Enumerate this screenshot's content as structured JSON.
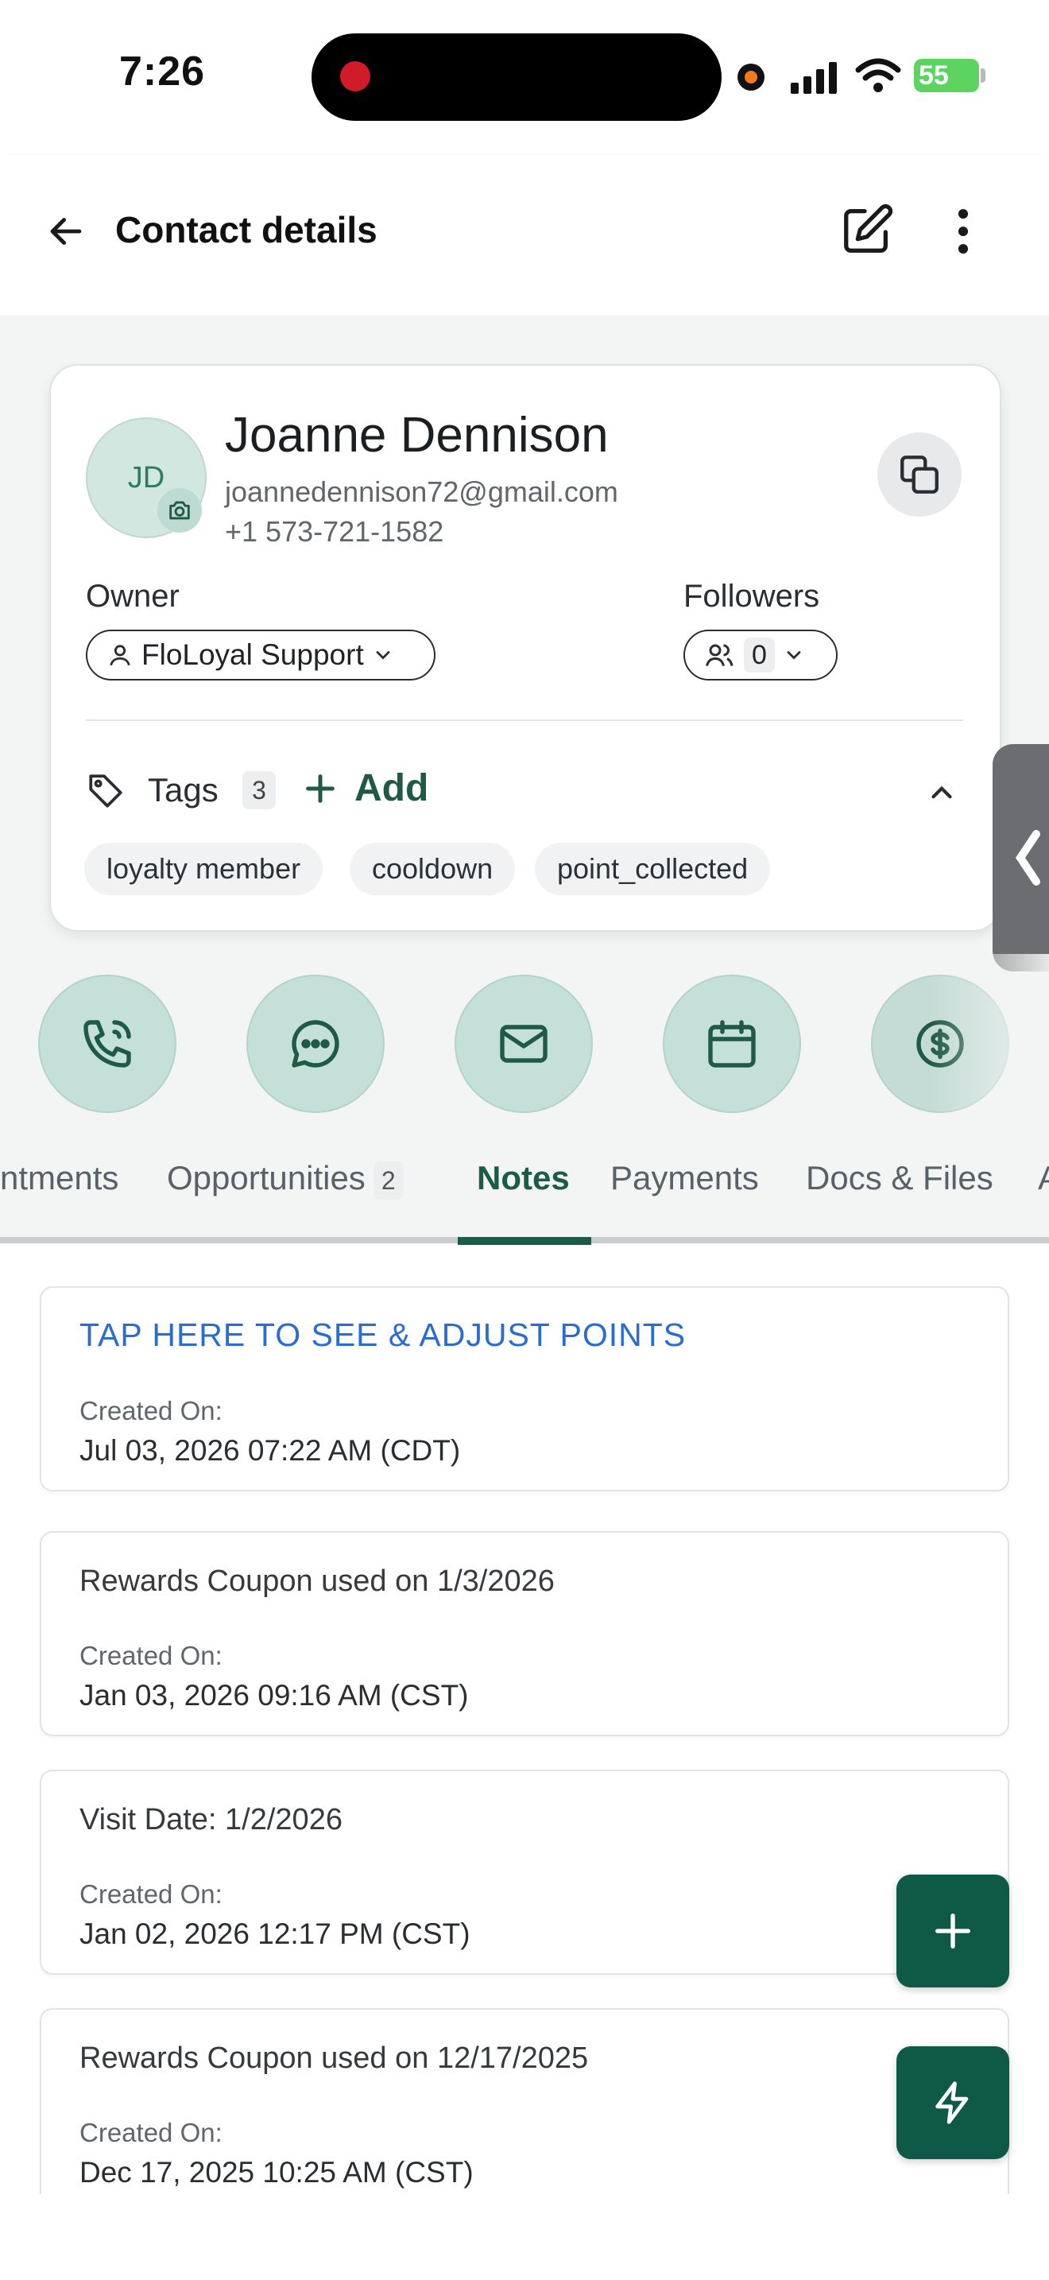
{
  "status_bar": {
    "time": "7:26",
    "battery": "55"
  },
  "header": {
    "title": "Contact details"
  },
  "contact": {
    "initials": "JD",
    "name": "Joanne Dennison",
    "email": "joannedennison72@gmail.com",
    "phone": "+1 573-721-1582",
    "owner_label": "Owner",
    "owner_value": "FloLoyal Support",
    "followers_label": "Followers",
    "followers_count": "0",
    "tags_label": "Tags",
    "tags_count": "3",
    "add_label": "Add",
    "tags": [
      "loyalty member",
      "cooldown",
      "point_collected"
    ]
  },
  "actions": [
    "phone-icon",
    "chat-icon",
    "mail-icon",
    "calendar-icon",
    "dollar-icon"
  ],
  "tabs": [
    {
      "label": "ntments"
    },
    {
      "label": "Opportunities",
      "badge": "2"
    },
    {
      "label": "Notes",
      "active": true
    },
    {
      "label": "Payments"
    },
    {
      "label": "Docs & Files"
    },
    {
      "label": "A"
    }
  ],
  "notes": [
    {
      "title": "TAP HERE TO SEE & ADJUST POINTS",
      "created_label": "Created On:",
      "date": "Jul 03, 2026 07:22 AM (CDT)"
    },
    {
      "title": "Rewards Coupon used on 1/3/2026",
      "created_label": "Created On:",
      "date": "Jan 03, 2026 09:16 AM (CST)"
    },
    {
      "title": "Visit Date: 1/2/2026",
      "created_label": "Created On:",
      "date": "Jan 02, 2026 12:17 PM (CST)"
    },
    {
      "title": "Rewards Coupon used on 12/17/2025",
      "created_label": "Created On:",
      "date": "Dec 17, 2025 10:25 AM (CST)"
    }
  ],
  "colors": {
    "accent": "#0f5a47",
    "link": "#2a6ccf",
    "action_bg": "#c4e0d8"
  }
}
